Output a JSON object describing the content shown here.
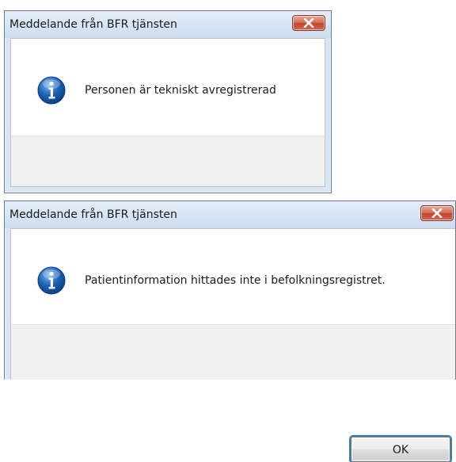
{
  "dialogs": [
    {
      "title": "Meddelande från BFR tjänsten",
      "message": "Personen är tekniskt avregistrerad",
      "icon": "info-icon",
      "ok_label": "OK"
    },
    {
      "title": "Meddelande från BFR tjänsten",
      "message": "Patientinformation hittades inte i befolkningsregistret.",
      "icon": "info-icon",
      "ok_label": "OK"
    }
  ],
  "colors": {
    "titlebar": "#cbdcef",
    "close_button": "#c1452c",
    "footer": "#f0f0f0",
    "info_icon": "#1b64b6"
  }
}
